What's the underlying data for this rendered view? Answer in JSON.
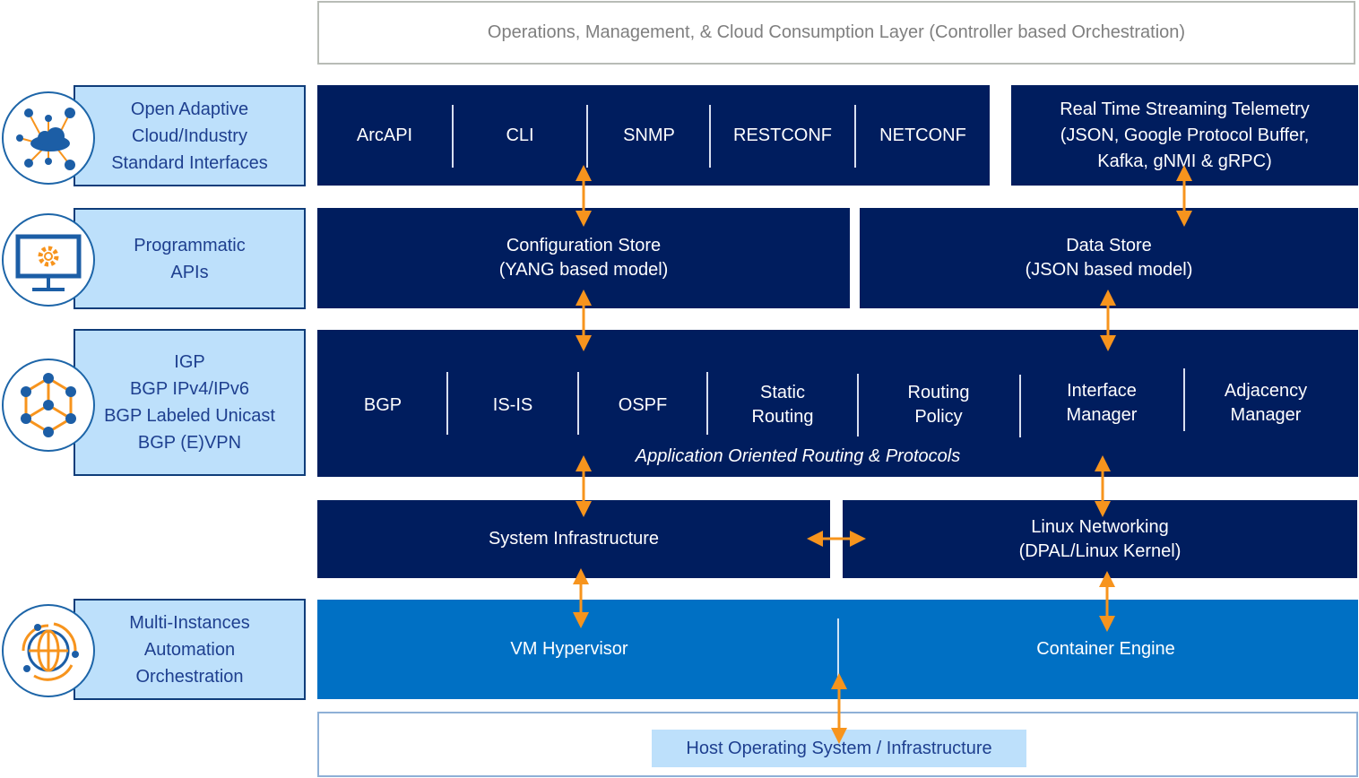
{
  "top_layer": {
    "label": "Operations, Management, & Cloud Consumption Layer (Controller based Orchestration)"
  },
  "sidebar": {
    "items": [
      {
        "icon": "cloud-network-icon",
        "lines": [
          "Open Adaptive",
          "Cloud/Industry",
          "Standard Interfaces"
        ]
      },
      {
        "icon": "monitor-gear-icon",
        "lines": [
          "Programmatic",
          "APIs"
        ]
      },
      {
        "icon": "hexagon-network-icon",
        "lines": [
          "IGP",
          "BGP IPv4/IPv6",
          "BGP Labeled Unicast",
          "BGP (E)VPN"
        ]
      },
      {
        "icon": "globe-orbit-icon",
        "lines": [
          "Multi-Instances",
          "Automation",
          "Orchestration"
        ]
      }
    ]
  },
  "interfaces": {
    "items": [
      "ArcAPI",
      "CLI",
      "SNMP",
      "RESTCONF",
      "NETCONF"
    ],
    "telemetry": [
      "Real Time Streaming Telemetry",
      "(JSON, Google Protocol  Buffer,",
      "Kafka, gNMI & gRPC)"
    ]
  },
  "stores": {
    "config": [
      "Configuration Store",
      "(YANG based model)"
    ],
    "data": [
      "Data Store",
      "(JSON based model)"
    ]
  },
  "routing": {
    "items": [
      [
        "BGP"
      ],
      [
        "IS-IS"
      ],
      [
        "OSPF"
      ],
      [
        "Static",
        "Routing"
      ],
      [
        "Routing",
        "Policy"
      ],
      [
        "Interface",
        "Manager"
      ],
      [
        "Adjacency",
        "Manager"
      ]
    ],
    "caption": "Application Oriented Routing & Protocols"
  },
  "infra": {
    "system": "System Infrastructure",
    "linux": [
      "Linux Networking",
      "(DPAL/Linux Kernel)"
    ]
  },
  "virtualization": {
    "vm": "VM Hypervisor",
    "container": "Container Engine"
  },
  "host": {
    "label": "Host Operating System / Infrastructure"
  },
  "colors": {
    "navy": "#001d5e",
    "blue": "#0070c4",
    "light_blue": "#bde0fb",
    "arrow": "#f7941d"
  }
}
